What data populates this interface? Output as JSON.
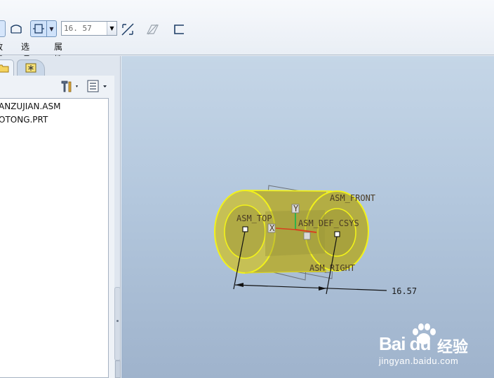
{
  "dashboard": {
    "offset_value": "16. 57",
    "tabs": [
      {
        "label": "放置"
      },
      {
        "label": "选项"
      },
      {
        "label": "属性"
      }
    ]
  },
  "navigator": {
    "tree": [
      {
        "label": "ANZUJIAN.ASM"
      },
      {
        "label": "OTONG.PRT"
      }
    ]
  },
  "graphics": {
    "datums": {
      "asm_front": "ASM_FRONT",
      "asm_top": "ASM_TOP",
      "asm_def_csys": "ASM_DEF_CSYS",
      "asm_right": "ASM_RIGHT"
    },
    "axis_labels": {
      "y": "Y",
      "x": "X"
    },
    "dimension_value": "16.57"
  },
  "watermark": {
    "brand": "Bai du",
    "product": "经验",
    "url": "jingyan.baidu.com"
  },
  "colors": {
    "part_fill": "#b9b347",
    "highlight_edge": "#f2f21a",
    "background_top": "#c5d6e7",
    "background_bottom": "#9fb3cc"
  }
}
